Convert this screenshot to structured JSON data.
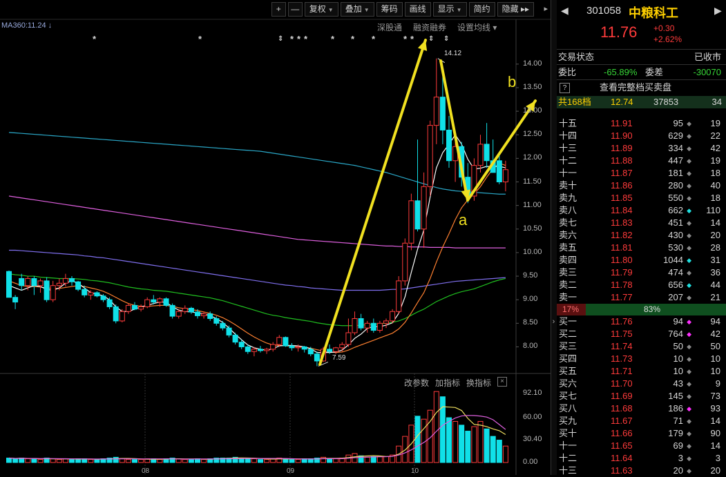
{
  "toolbar": {
    "buttons": [
      {
        "label": "+",
        "caret": false
      },
      {
        "label": "—",
        "caret": false
      },
      {
        "label": "复权",
        "caret": true
      },
      {
        "label": "叠加",
        "caret": true
      },
      {
        "label": "筹码",
        "caret": false
      },
      {
        "label": "画线",
        "caret": false
      },
      {
        "label": "显示",
        "caret": true
      },
      {
        "label": "简约",
        "caret": false
      },
      {
        "label": "隐藏 ▸▸",
        "caret": false
      }
    ],
    "overflow_label": "▸"
  },
  "ma_label": "MA360:11.24 ↓",
  "top_links": [
    "深股通",
    "融资融券",
    "设置均线 ▾"
  ],
  "sub_links": [
    "改参数",
    "加指标",
    "换指标"
  ],
  "sub_close": "×",
  "annotations": {
    "a": "a",
    "b": "b"
  },
  "price_high_label": "14.12",
  "price_low_label": "7.59",
  "chart_data": {
    "type": "candlestick",
    "y_axis_ticks": [
      14.0,
      13.5,
      13.0,
      12.5,
      12.0,
      11.5,
      11.0,
      10.5,
      10.0,
      9.5,
      9.0,
      8.5,
      8.0
    ],
    "y_range": [
      7.45,
      14.95
    ],
    "x_labels": [
      "08",
      "09",
      "10"
    ],
    "volume_axis_ticks": [
      "92.10",
      "60.00",
      "30.40",
      "0.00"
    ],
    "volume_range": [
      0,
      97
    ],
    "candles_ohlc": [
      [
        9.6,
        9.62,
        9.05,
        9.05
      ],
      [
        9.05,
        9.1,
        8.8,
        8.95
      ],
      [
        9.45,
        9.55,
        9.2,
        9.3
      ],
      [
        9.3,
        9.5,
        9.2,
        9.45
      ],
      [
        9.45,
        9.5,
        9.1,
        9.3
      ],
      [
        9.3,
        9.45,
        9.15,
        9.4
      ],
      [
        9.4,
        9.48,
        8.95,
        9.0
      ],
      [
        9.0,
        9.4,
        8.95,
        9.3
      ],
      [
        9.3,
        9.45,
        9.2,
        9.35
      ],
      [
        9.35,
        9.55,
        9.28,
        9.45
      ],
      [
        9.45,
        9.5,
        9.3,
        9.38
      ],
      [
        9.38,
        9.4,
        9.18,
        9.22
      ],
      [
        9.22,
        9.3,
        9.05,
        9.1
      ],
      [
        9.1,
        9.2,
        9.0,
        9.15
      ],
      [
        9.15,
        9.18,
        9.05,
        9.08
      ],
      [
        9.08,
        9.12,
        8.95,
        9.0
      ],
      [
        9.0,
        9.05,
        8.8,
        8.85
      ],
      [
        8.85,
        8.9,
        8.5,
        8.55
      ],
      [
        8.55,
        8.8,
        8.52,
        8.75
      ],
      [
        8.75,
        8.92,
        8.7,
        8.88
      ],
      [
        8.88,
        8.95,
        8.78,
        8.8
      ],
      [
        8.8,
        8.9,
        8.75,
        8.85
      ],
      [
        8.85,
        9.05,
        8.82,
        9.0
      ],
      [
        9.0,
        9.1,
        8.9,
        8.95
      ],
      [
        8.95,
        9.05,
        8.85,
        9.02
      ],
      [
        9.02,
        9.05,
        8.85,
        8.88
      ],
      [
        8.88,
        8.92,
        8.6,
        8.65
      ],
      [
        8.65,
        8.8,
        8.6,
        8.75
      ],
      [
        8.75,
        8.88,
        8.7,
        8.82
      ],
      [
        8.82,
        8.85,
        8.7,
        8.74
      ],
      [
        8.74,
        8.8,
        8.6,
        8.66
      ],
      [
        8.66,
        8.75,
        8.6,
        8.7
      ],
      [
        8.7,
        8.75,
        8.55,
        8.6
      ],
      [
        8.6,
        8.65,
        8.45,
        8.5
      ],
      [
        8.5,
        8.55,
        8.35,
        8.4
      ],
      [
        8.4,
        8.45,
        8.2,
        8.25
      ],
      [
        8.25,
        8.3,
        8.05,
        8.1
      ],
      [
        8.1,
        8.15,
        7.95,
        8.0
      ],
      [
        8.0,
        8.05,
        7.85,
        7.9
      ],
      [
        7.9,
        8.0,
        7.8,
        7.95
      ],
      [
        7.95,
        8.02,
        7.88,
        7.92
      ],
      [
        7.92,
        7.98,
        7.85,
        7.95
      ],
      [
        7.95,
        8.1,
        7.9,
        8.05
      ],
      [
        8.05,
        8.25,
        8.0,
        8.2
      ],
      [
        8.2,
        8.22,
        8.0,
        8.02
      ],
      [
        8.02,
        8.08,
        7.92,
        7.98
      ],
      [
        7.98,
        8.05,
        7.9,
        8.0
      ],
      [
        8.0,
        8.02,
        7.88,
        7.95
      ],
      [
        7.95,
        8.0,
        7.8,
        7.85
      ],
      [
        7.85,
        7.9,
        7.59,
        7.7
      ],
      [
        7.7,
        8.0,
        7.68,
        7.95
      ],
      [
        7.95,
        8.05,
        7.85,
        7.9
      ],
      [
        7.9,
        8.0,
        7.85,
        7.98
      ],
      [
        7.98,
        8.1,
        7.9,
        8.05
      ],
      [
        8.05,
        8.6,
        8.0,
        8.3
      ],
      [
        8.3,
        8.75,
        8.25,
        8.6
      ],
      [
        8.6,
        8.7,
        8.35,
        8.4
      ],
      [
        8.4,
        8.55,
        8.3,
        8.5
      ],
      [
        8.5,
        8.6,
        8.3,
        8.35
      ],
      [
        8.35,
        8.55,
        8.3,
        8.5
      ],
      [
        8.5,
        8.6,
        8.4,
        8.55
      ],
      [
        8.55,
        8.8,
        8.5,
        8.75
      ],
      [
        8.75,
        9.5,
        8.7,
        9.4
      ],
      [
        9.4,
        10.3,
        9.3,
        10.2
      ],
      [
        10.2,
        11.25,
        10.05,
        11.1
      ],
      [
        11.1,
        12.4,
        10.45,
        10.5
      ],
      [
        10.5,
        11.7,
        10.1,
        11.4
      ],
      [
        11.4,
        12.8,
        11.2,
        12.7
      ],
      [
        12.7,
        14.12,
        12.3,
        13.3
      ],
      [
        13.3,
        13.95,
        12.3,
        12.6
      ],
      [
        12.6,
        12.9,
        11.8,
        11.95
      ],
      [
        11.95,
        12.5,
        11.5,
        12.25
      ],
      [
        12.25,
        12.35,
        11.4,
        11.6
      ],
      [
        11.6,
        11.9,
        11.05,
        11.2
      ],
      [
        11.2,
        12.0,
        11.1,
        11.85
      ],
      [
        11.85,
        12.5,
        11.7,
        12.3
      ],
      [
        12.3,
        12.75,
        11.8,
        11.95
      ],
      [
        11.95,
        12.4,
        11.75,
        11.7
      ],
      [
        11.95,
        12.1,
        11.45,
        11.5
      ],
      [
        11.5,
        11.95,
        11.3,
        11.76
      ]
    ],
    "volumes": [
      6,
      5,
      6,
      5,
      5,
      4,
      6,
      5,
      4,
      5,
      4,
      5,
      5,
      4,
      4,
      5,
      6,
      7,
      5,
      4,
      4,
      4,
      5,
      5,
      4,
      5,
      6,
      5,
      4,
      4,
      5,
      4,
      5,
      6,
      6,
      6,
      7,
      6,
      5,
      5,
      4,
      4,
      5,
      6,
      5,
      4,
      4,
      5,
      5,
      6,
      7,
      5,
      5,
      6,
      10,
      12,
      9,
      7,
      8,
      8,
      8,
      10,
      22,
      35,
      50,
      62,
      58,
      70,
      95,
      88,
      60,
      55,
      50,
      42,
      48,
      55,
      45,
      35,
      30,
      22
    ],
    "ma_short": [
      9.3,
      9.25,
      9.2,
      9.25,
      9.3,
      9.28,
      9.22,
      9.2,
      9.25,
      9.35,
      9.4,
      9.35,
      9.25,
      9.15,
      9.12,
      9.08,
      9.0,
      8.85,
      8.75,
      8.75,
      8.8,
      8.85,
      8.88,
      8.92,
      8.95,
      8.95,
      8.85,
      8.78,
      8.75,
      8.74,
      8.72,
      8.7,
      8.66,
      8.6,
      8.52,
      8.4,
      8.27,
      8.15,
      8.04,
      7.98,
      7.95,
      7.93,
      7.96,
      8.02,
      8.03,
      8.03,
      8.02,
      8.0,
      7.96,
      7.88,
      7.88,
      7.88,
      7.89,
      7.93,
      8.04,
      8.18,
      8.27,
      8.39,
      8.43,
      8.43,
      8.46,
      8.51,
      8.71,
      9.06,
      9.58,
      10.07,
      10.48,
      11.18,
      11.8,
      12.12,
      12.3,
      12.5,
      12.3,
      11.98,
      11.77,
      11.79,
      11.83,
      11.82,
      11.83,
      11.8
    ],
    "ma_mid": [
      9.4,
      9.35,
      9.3,
      9.28,
      9.28,
      9.27,
      9.25,
      9.24,
      9.24,
      9.26,
      9.28,
      9.3,
      9.28,
      9.25,
      9.22,
      9.18,
      9.12,
      9.05,
      8.98,
      8.92,
      8.88,
      8.86,
      8.86,
      8.87,
      8.88,
      8.88,
      8.86,
      8.83,
      8.81,
      8.79,
      8.77,
      8.74,
      8.71,
      8.67,
      8.62,
      8.55,
      8.47,
      8.38,
      8.29,
      8.21,
      8.14,
      8.08,
      8.04,
      8.03,
      8.02,
      8.01,
      8.0,
      7.99,
      7.97,
      7.94,
      7.91,
      7.89,
      7.88,
      7.89,
      7.93,
      7.99,
      8.04,
      8.09,
      8.14,
      8.19,
      8.24,
      8.29,
      8.38,
      8.52,
      8.72,
      8.94,
      9.15,
      9.45,
      9.8,
      10.12,
      10.4,
      10.7,
      10.95,
      11.12,
      11.25,
      11.4,
      11.6,
      11.78,
      11.9,
      11.85
    ],
    "ma_long1": [
      9.55,
      9.53,
      9.52,
      9.5,
      9.5,
      9.48,
      9.47,
      9.46,
      9.45,
      9.45,
      9.45,
      9.44,
      9.43,
      9.41,
      9.4,
      9.38,
      9.36,
      9.33,
      9.3,
      9.27,
      9.25,
      9.23,
      9.22,
      9.2,
      9.19,
      9.18,
      9.16,
      9.14,
      9.12,
      9.1,
      9.08,
      9.06,
      9.04,
      9.01,
      8.98,
      8.94,
      8.9,
      8.86,
      8.82,
      8.78,
      8.74,
      8.7,
      8.67,
      8.65,
      8.62,
      8.6,
      8.58,
      8.56,
      8.54,
      8.51,
      8.49,
      8.47,
      8.46,
      8.45,
      8.45,
      8.45,
      8.46,
      8.47,
      8.48,
      8.49,
      8.5,
      8.52,
      8.55,
      8.6,
      8.67,
      8.74,
      8.8,
      8.88,
      8.96,
      9.02,
      9.08,
      9.13,
      9.17,
      9.2,
      9.23,
      9.28,
      9.33,
      9.38,
      9.42,
      9.45
    ],
    "ma_long2": [
      10.05,
      10.05,
      10.04,
      10.03,
      10.02,
      10.01,
      10.0,
      9.99,
      9.98,
      9.97,
      9.96,
      9.95,
      9.93,
      9.92,
      9.9,
      9.89,
      9.87,
      9.85,
      9.83,
      9.81,
      9.79,
      9.77,
      9.75,
      9.73,
      9.71,
      9.69,
      9.67,
      9.65,
      9.63,
      9.61,
      9.59,
      9.57,
      9.55,
      9.53,
      9.51,
      9.49,
      9.47,
      9.45,
      9.43,
      9.41,
      9.39,
      9.37,
      9.35,
      9.33,
      9.31,
      9.3,
      9.28,
      9.27,
      9.25,
      9.24,
      9.23,
      9.22,
      9.21,
      9.2,
      9.2,
      9.2,
      9.2,
      9.2,
      9.2,
      9.2,
      9.21,
      9.22,
      9.22,
      9.23,
      9.25,
      9.27,
      9.29,
      9.31,
      9.33,
      9.35,
      9.37,
      9.39,
      9.4,
      9.41,
      9.42,
      9.43,
      9.44,
      9.45,
      9.46,
      9.47
    ],
    "ma_long3": [
      11.2,
      11.18,
      11.16,
      11.14,
      11.12,
      11.1,
      11.08,
      11.06,
      11.04,
      11.02,
      11.0,
      10.98,
      10.96,
      10.94,
      10.92,
      10.9,
      10.88,
      10.86,
      10.84,
      10.82,
      10.8,
      10.78,
      10.76,
      10.74,
      10.72,
      10.7,
      10.68,
      10.66,
      10.64,
      10.62,
      10.6,
      10.58,
      10.56,
      10.54,
      10.52,
      10.5,
      10.48,
      10.46,
      10.44,
      10.42,
      10.4,
      10.38,
      10.36,
      10.34,
      10.32,
      10.3,
      10.28,
      10.27,
      10.26,
      10.25,
      10.24,
      10.23,
      10.22,
      10.21,
      10.2,
      10.19,
      10.18,
      10.17,
      10.16,
      10.15,
      10.14,
      10.14,
      10.13,
      10.13,
      10.12,
      10.12,
      10.12,
      10.11,
      10.11,
      10.11,
      10.11,
      10.1,
      10.1,
      10.1,
      10.1,
      10.1,
      10.1,
      10.1,
      10.1,
      10.1
    ],
    "ma360": [
      12.55,
      12.54,
      12.53,
      12.52,
      12.51,
      12.5,
      12.49,
      12.48,
      12.47,
      12.46,
      12.45,
      12.44,
      12.43,
      12.42,
      12.41,
      12.4,
      12.39,
      12.38,
      12.37,
      12.36,
      12.35,
      12.34,
      12.33,
      12.32,
      12.31,
      12.3,
      12.29,
      12.28,
      12.27,
      12.26,
      12.25,
      12.24,
      12.23,
      12.22,
      12.21,
      12.2,
      12.19,
      12.18,
      12.17,
      12.16,
      12.15,
      12.13,
      12.11,
      12.09,
      12.07,
      12.05,
      12.03,
      12.01,
      11.99,
      11.97,
      11.95,
      11.93,
      11.91,
      11.89,
      11.87,
      11.85,
      11.82,
      11.79,
      11.76,
      11.73,
      11.7,
      11.66,
      11.62,
      11.58,
      11.54,
      11.5,
      11.46,
      11.42,
      11.38,
      11.35,
      11.33,
      11.31,
      11.3,
      11.29,
      11.28,
      11.27,
      11.26,
      11.25,
      11.24,
      11.24
    ]
  },
  "stock": {
    "nav_left": "◀",
    "nav_right": "▶",
    "code": "301058",
    "name": "中粮科工",
    "price": "11.76",
    "change": "+0.30",
    "change_pct": "+2.62%"
  },
  "status": {
    "label": "交易状态",
    "value": "已收市"
  },
  "ratio": {
    "label1": "委比",
    "value1": "-65.89%",
    "label2": "委差",
    "value2": "-30070"
  },
  "full_book": {
    "q": "?",
    "label": "查看完整档买卖盘"
  },
  "total": {
    "label": "共168档",
    "price": "12.74",
    "vol": "37853",
    "count": "34"
  },
  "asks": [
    {
      "label": "十五",
      "price": "11.91",
      "vol": "95",
      "mark": "dot",
      "count": "19"
    },
    {
      "label": "十四",
      "price": "11.90",
      "vol": "629",
      "mark": "dot",
      "count": "22"
    },
    {
      "label": "十三",
      "price": "11.89",
      "vol": "334",
      "mark": "dot",
      "count": "42"
    },
    {
      "label": "十二",
      "price": "11.88",
      "vol": "447",
      "mark": "dot",
      "count": "19"
    },
    {
      "label": "十一",
      "price": "11.87",
      "vol": "181",
      "mark": "dot",
      "count": "18"
    },
    {
      "label": "卖十",
      "price": "11.86",
      "vol": "280",
      "mark": "dot",
      "count": "40"
    },
    {
      "label": "卖九",
      "price": "11.85",
      "vol": "550",
      "mark": "dot",
      "count": "18"
    },
    {
      "label": "卖八",
      "price": "11.84",
      "vol": "662",
      "mark": "cyan",
      "count": "110"
    },
    {
      "label": "卖七",
      "price": "11.83",
      "vol": "451",
      "mark": "dot",
      "count": "14"
    },
    {
      "label": "卖六",
      "price": "11.82",
      "vol": "430",
      "mark": "dot",
      "count": "20"
    },
    {
      "label": "卖五",
      "price": "11.81",
      "vol": "530",
      "mark": "dot",
      "count": "28"
    },
    {
      "label": "卖四",
      "price": "11.80",
      "vol": "1044",
      "mark": "cyan",
      "count": "31"
    },
    {
      "label": "卖三",
      "price": "11.79",
      "vol": "474",
      "mark": "dot",
      "count": "36"
    },
    {
      "label": "卖二",
      "price": "11.78",
      "vol": "656",
      "mark": "cyan",
      "count": "44"
    },
    {
      "label": "卖一",
      "price": "11.77",
      "vol": "207",
      "mark": "dot",
      "count": "21"
    }
  ],
  "balance": {
    "left_pct": "17%",
    "right_pct": "83%",
    "left_fraction": 0.17
  },
  "bids": [
    {
      "label": "买一",
      "price": "11.76",
      "vol": "94",
      "mark": "magenta",
      "count": "94"
    },
    {
      "label": "买二",
      "price": "11.75",
      "vol": "764",
      "mark": "magenta",
      "count": "42"
    },
    {
      "label": "买三",
      "price": "11.74",
      "vol": "50",
      "mark": "dot",
      "count": "50"
    },
    {
      "label": "买四",
      "price": "11.73",
      "vol": "10",
      "mark": "dot",
      "count": "10"
    },
    {
      "label": "买五",
      "price": "11.71",
      "vol": "10",
      "mark": "dot",
      "count": "10"
    },
    {
      "label": "买六",
      "price": "11.70",
      "vol": "43",
      "mark": "dot",
      "count": "9"
    },
    {
      "label": "买七",
      "price": "11.69",
      "vol": "145",
      "mark": "dot",
      "count": "73"
    },
    {
      "label": "买八",
      "price": "11.68",
      "vol": "186",
      "mark": "magenta",
      "count": "93"
    },
    {
      "label": "买九",
      "price": "11.67",
      "vol": "71",
      "mark": "dot",
      "count": "14"
    },
    {
      "label": "买十",
      "price": "11.66",
      "vol": "179",
      "mark": "dot",
      "count": "90"
    },
    {
      "label": "十一",
      "price": "11.65",
      "vol": "69",
      "mark": "dot",
      "count": "14"
    },
    {
      "label": "十二",
      "price": "11.64",
      "vol": "3",
      "mark": "dot",
      "count": "3"
    },
    {
      "label": "十三",
      "price": "11.63",
      "vol": "20",
      "mark": "dot",
      "count": "20"
    }
  ],
  "colors": {
    "up": "#ff3b3b",
    "down": "#10e0e8",
    "accent": "#ffd000",
    "arrow": "#f0e020",
    "ma_short": "#ffffff",
    "ma_mid": "#ff8030",
    "ma_long1": "#20c020",
    "ma_long2": "#8070f0",
    "ma_long3": "#e060e0",
    "ma360": "#2aa8c8",
    "green_bar": "#0f4f1f"
  }
}
